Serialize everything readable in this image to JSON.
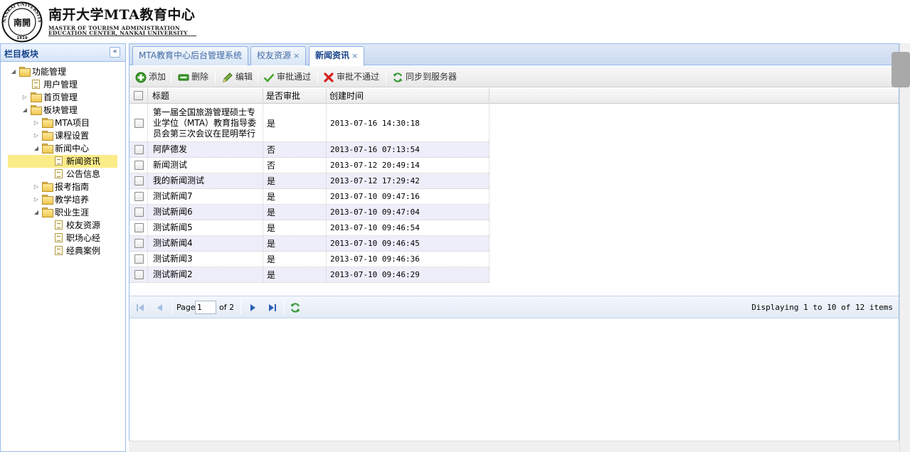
{
  "header": {
    "title": "南开大学MTA教育中心",
    "subtitle_line1": "MASTER OF TOURISM ADMINISTRATION",
    "subtitle_line2": "EDUCATION CENTER, NANKAI UNIVERSITY",
    "seal_text_top": "NANKAI UNIVERSITY",
    "seal_text_center": "南開",
    "seal_year": "1919"
  },
  "west": {
    "title": "栏目板块",
    "collapse_icon": "double-chevron-left-icon",
    "tree": [
      {
        "label": "功能管理",
        "icon": "folder-open",
        "arrow": "expanded",
        "level": 0
      },
      {
        "label": "用户管理",
        "icon": "document",
        "arrow": "none",
        "level": 1
      },
      {
        "label": "首页管理",
        "icon": "folder",
        "arrow": "collapsed",
        "level": 1
      },
      {
        "label": "板块管理",
        "icon": "folder-open",
        "arrow": "expanded",
        "level": 1
      },
      {
        "label": "MTA项目",
        "icon": "folder",
        "arrow": "collapsed",
        "level": 2
      },
      {
        "label": "课程设置",
        "icon": "folder",
        "arrow": "collapsed",
        "level": 2
      },
      {
        "label": "新闻中心",
        "icon": "folder-open",
        "arrow": "expanded",
        "level": 2
      },
      {
        "label": "新闻资讯",
        "icon": "document",
        "arrow": "none",
        "level": 3,
        "selected": true
      },
      {
        "label": "公告信息",
        "icon": "document",
        "arrow": "none",
        "level": 3
      },
      {
        "label": "报考指南",
        "icon": "folder",
        "arrow": "collapsed",
        "level": 2
      },
      {
        "label": "教学培养",
        "icon": "folder",
        "arrow": "collapsed",
        "level": 2
      },
      {
        "label": "职业生涯",
        "icon": "folder-open",
        "arrow": "expanded",
        "level": 2
      },
      {
        "label": "校友资源",
        "icon": "document",
        "arrow": "none",
        "level": 3
      },
      {
        "label": "职场心经",
        "icon": "document",
        "arrow": "none",
        "level": 3
      },
      {
        "label": "经典案例",
        "icon": "document",
        "arrow": "none",
        "level": 3
      }
    ]
  },
  "tabs": [
    {
      "label": "MTA教育中心后台管理系统",
      "closable": false,
      "active": false
    },
    {
      "label": "校友资源",
      "closable": true,
      "active": false
    },
    {
      "label": "新闻资讯",
      "closable": true,
      "active": true
    }
  ],
  "tab_close_glyph": "×",
  "toolbar": {
    "add": "添加",
    "delete": "删除",
    "edit": "编辑",
    "approve": "审批通过",
    "reject": "审批不通过",
    "sync": "同步到服务器"
  },
  "grid": {
    "columns": [
      "标题",
      "是否审批",
      "创建时间"
    ],
    "rows": [
      {
        "title": "第一届全国旅游管理硕士专业学位（MTA）教育指导委员会第三次会议在昆明举行",
        "approved": "是",
        "created": "2013-07-16 14:30:18"
      },
      {
        "title": "阿萨德发",
        "approved": "否",
        "created": "2013-07-16 07:13:54"
      },
      {
        "title": "新闻测试",
        "approved": "否",
        "created": "2013-07-12 20:49:14"
      },
      {
        "title": "我的新闻测试",
        "approved": "是",
        "created": "2013-07-12 17:29:42"
      },
      {
        "title": "测试新闻7",
        "approved": "是",
        "created": "2013-07-10 09:47:16"
      },
      {
        "title": "测试新闻6",
        "approved": "是",
        "created": "2013-07-10 09:47:04"
      },
      {
        "title": "测试新闻5",
        "approved": "是",
        "created": "2013-07-10 09:46:54"
      },
      {
        "title": "测试新闻4",
        "approved": "是",
        "created": "2013-07-10 09:46:45"
      },
      {
        "title": "测试新闻3",
        "approved": "是",
        "created": "2013-07-10 09:46:36"
      },
      {
        "title": "测试新闻2",
        "approved": "是",
        "created": "2013-07-10 09:46:29"
      }
    ]
  },
  "pager": {
    "page_label": "Page",
    "page_value": "1",
    "of_label": "of 2",
    "info": "Displaying 1 to 10 of 12 items"
  },
  "colors": {
    "panel_border": "#99bbe8",
    "header_text": "#15428b",
    "selected_node": "#fbec88",
    "alt_row": "#eeeefa"
  }
}
